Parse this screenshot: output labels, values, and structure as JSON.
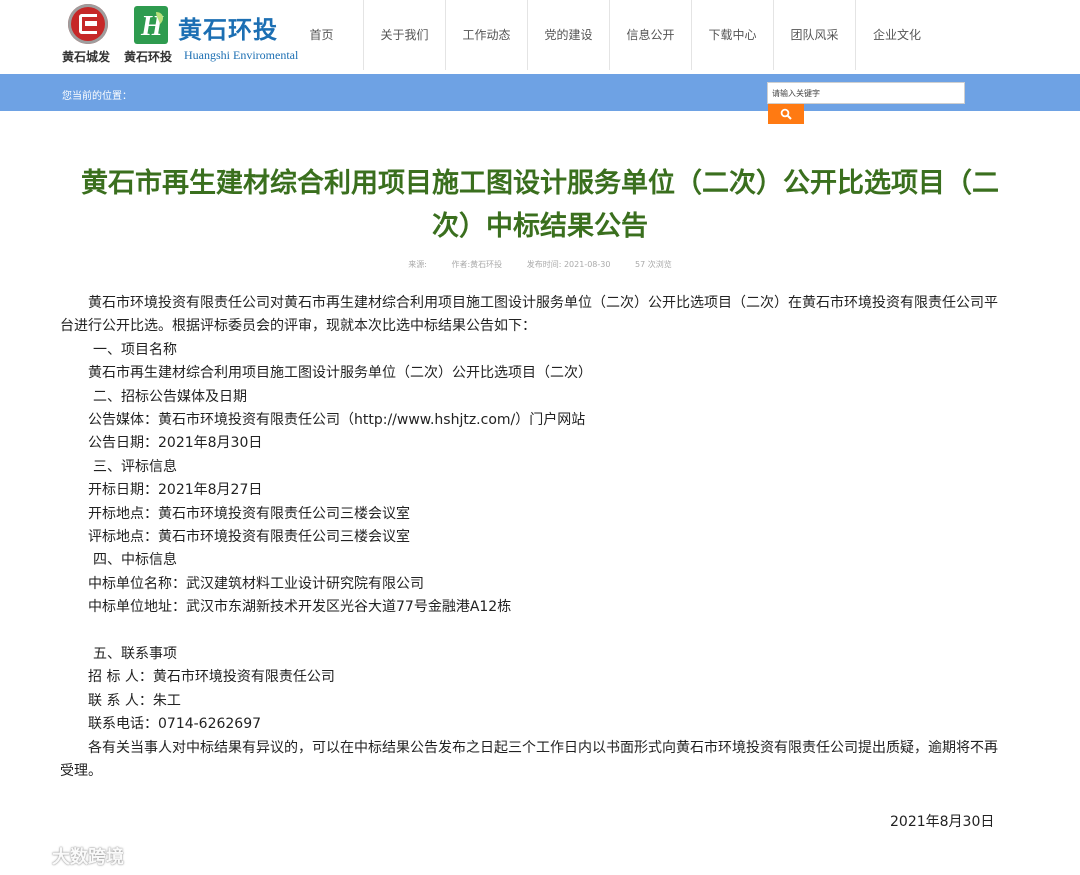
{
  "header": {
    "logo1_name": "黄石城发",
    "logo2_mark_text": "H",
    "logo2_cn": "黄石环投",
    "logo2_sub": "黄石环投",
    "logo2_en": "Huangshi Enviromental",
    "nav": [
      "首页",
      "关于我们",
      "工作动态",
      "党的建设",
      "信息公开",
      "下载中心",
      "团队风采",
      "企业文化"
    ]
  },
  "bar": {
    "crumb": "您当前的位置：",
    "search_placeholder": "请输入关键字",
    "accent": "#6ea2e4",
    "button_color": "#ff7a12"
  },
  "article": {
    "title": "黄石市再生建材综合利用项目施工图设计服务单位（二次）公开比选项目（二次）中标结果公告",
    "meta": {
      "source": "来源:",
      "author": "作者:黄石环投",
      "date": "发布时间: 2021-08-30",
      "views": "57 次浏览"
    },
    "intro": "黄石市环境投资有限责任公司对黄石市再生建材综合利用项目施工图设计服务单位（二次）公开比选项目（二次）在黄石市环境投资有限责任公司平台进行公开比选。根据评标委员会的评审，现就本次比选中标结果公告如下：",
    "s1_head": "一、项目名称",
    "s1_body": "黄石市再生建材综合利用项目施工图设计服务单位（二次）公开比选项目（二次）",
    "s2_head": "二、招标公告媒体及日期",
    "s2_media": "公告媒体：黄石市环境投资有限责任公司（http://www.hshjtz.com/）门户网站",
    "s2_date": "公告日期：2021年8月30日",
    "s3_head": "三、评标信息",
    "s3_open_date": "开标日期：2021年8月27日",
    "s3_open_place": "开标地点：黄石市环境投资有限责任公司三楼会议室",
    "s3_eval_place": "评标地点：黄石市环境投资有限责任公司三楼会议室",
    "s4_head": "四、中标信息",
    "s4_winner": "中标单位名称：武汉建筑材料工业设计研究院有限公司",
    "s4_address": "中标单位地址：武汉市东湖新技术开发区光谷大道77号金融港A12栋",
    "s5_head": "五、联系事项",
    "s5_tenderer": "招 标 人：黄石市环境投资有限责任公司",
    "s5_contact": "联 系 人：朱工",
    "s5_phone": "联系电话：0714-6262697",
    "closing": "各有关当事人对中标结果有异议的，可以在中标结果公告发布之日起三个工作日内以书面形式向黄石市环境投资有限责任公司提出质疑，逾期将不再受理。",
    "sign_date": "2021年8月30日"
  },
  "watermark": "大数跨境",
  "colors": {
    "title": "#3a6f1e",
    "brand_blue": "#1c6fb3",
    "brand_green": "#2e9b4f",
    "brand_red": "#c62828"
  }
}
